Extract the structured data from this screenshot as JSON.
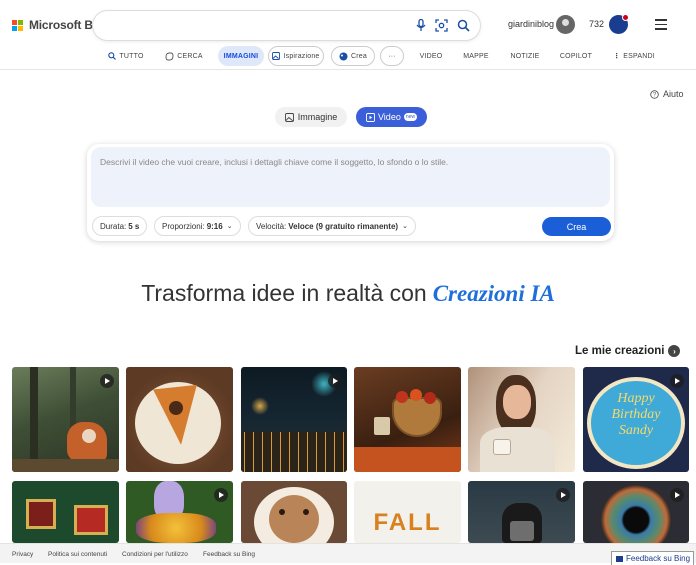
{
  "header": {
    "brand": "Microsoft Bing",
    "logo_colors": [
      "#f25022",
      "#7fba00",
      "#00a4ef",
      "#ffb900"
    ],
    "search_value": "",
    "icons": [
      "microphone-icon",
      "visual-search-icon",
      "search-icon"
    ],
    "user_name": "giardiniblog",
    "reward_points": "732",
    "menu_icon": "hamburger-icon"
  },
  "nav": {
    "items": [
      {
        "label": "TUTTO",
        "icon": "search-icon"
      },
      {
        "label": "CERCA",
        "icon": "copilot-icon"
      },
      {
        "label": "IMMAGINI",
        "active": true
      },
      {
        "label": "Ispirazione",
        "icon": "image-icon"
      },
      {
        "label": "Crea",
        "icon": "paint-icon"
      },
      {
        "label": "···"
      },
      {
        "label": "VIDEO"
      },
      {
        "label": "MAPPE"
      },
      {
        "label": "NOTIZIE"
      },
      {
        "label": "COPILOT"
      },
      {
        "label": "ESPANDI",
        "icon": "more-vertical-icon"
      }
    ]
  },
  "help_label": "Aiuto",
  "modes": {
    "image": "Immagine",
    "video": "Video",
    "video_badge": "new"
  },
  "prompt": {
    "placeholder": "Descrivi il video che vuoi creare, inclusi i dettagli chiave come il soggetto, lo sfondo o lo stile.",
    "duration_label": "Durata:",
    "duration_value": "5 s",
    "ratio_label": "Proporzioni:",
    "ratio_value": "9:16",
    "speed_label": "Velocità:",
    "speed_value": "Veloce (9 gratuito rimanente)",
    "create_label": "Crea"
  },
  "headline": {
    "text": "Trasforma idee in realtà con",
    "brand": "Creazioni IA"
  },
  "my_creations": {
    "title": "Le mie creazioni",
    "items": [
      {
        "subject": "fox in forest",
        "video": true
      },
      {
        "subject": "pumpkin pie slice",
        "video": false
      },
      {
        "subject": "city fireworks at night",
        "video": true
      },
      {
        "subject": "apple basket autumn",
        "video": false
      },
      {
        "subject": "woman with coffee",
        "video": false
      },
      {
        "subject": "birthday cake",
        "video": true,
        "text": [
          "Happy",
          "Birthday",
          "Sandy"
        ]
      },
      {
        "subject": "christmas gifts",
        "video": false
      },
      {
        "subject": "flower bouquet",
        "video": true
      },
      {
        "subject": "latte art bear",
        "video": false
      },
      {
        "subject": "fall lettering",
        "video": false,
        "text": [
          "FALL"
        ]
      },
      {
        "subject": "dog photographer",
        "video": true
      },
      {
        "subject": "eye close-up",
        "video": true
      }
    ]
  },
  "footer": {
    "links": [
      "Privacy",
      "Politica sui contenuti",
      "Condizioni per l'utilizzo",
      "Feedback su Bing"
    ],
    "feedback_button": "Feedback su Bing"
  }
}
